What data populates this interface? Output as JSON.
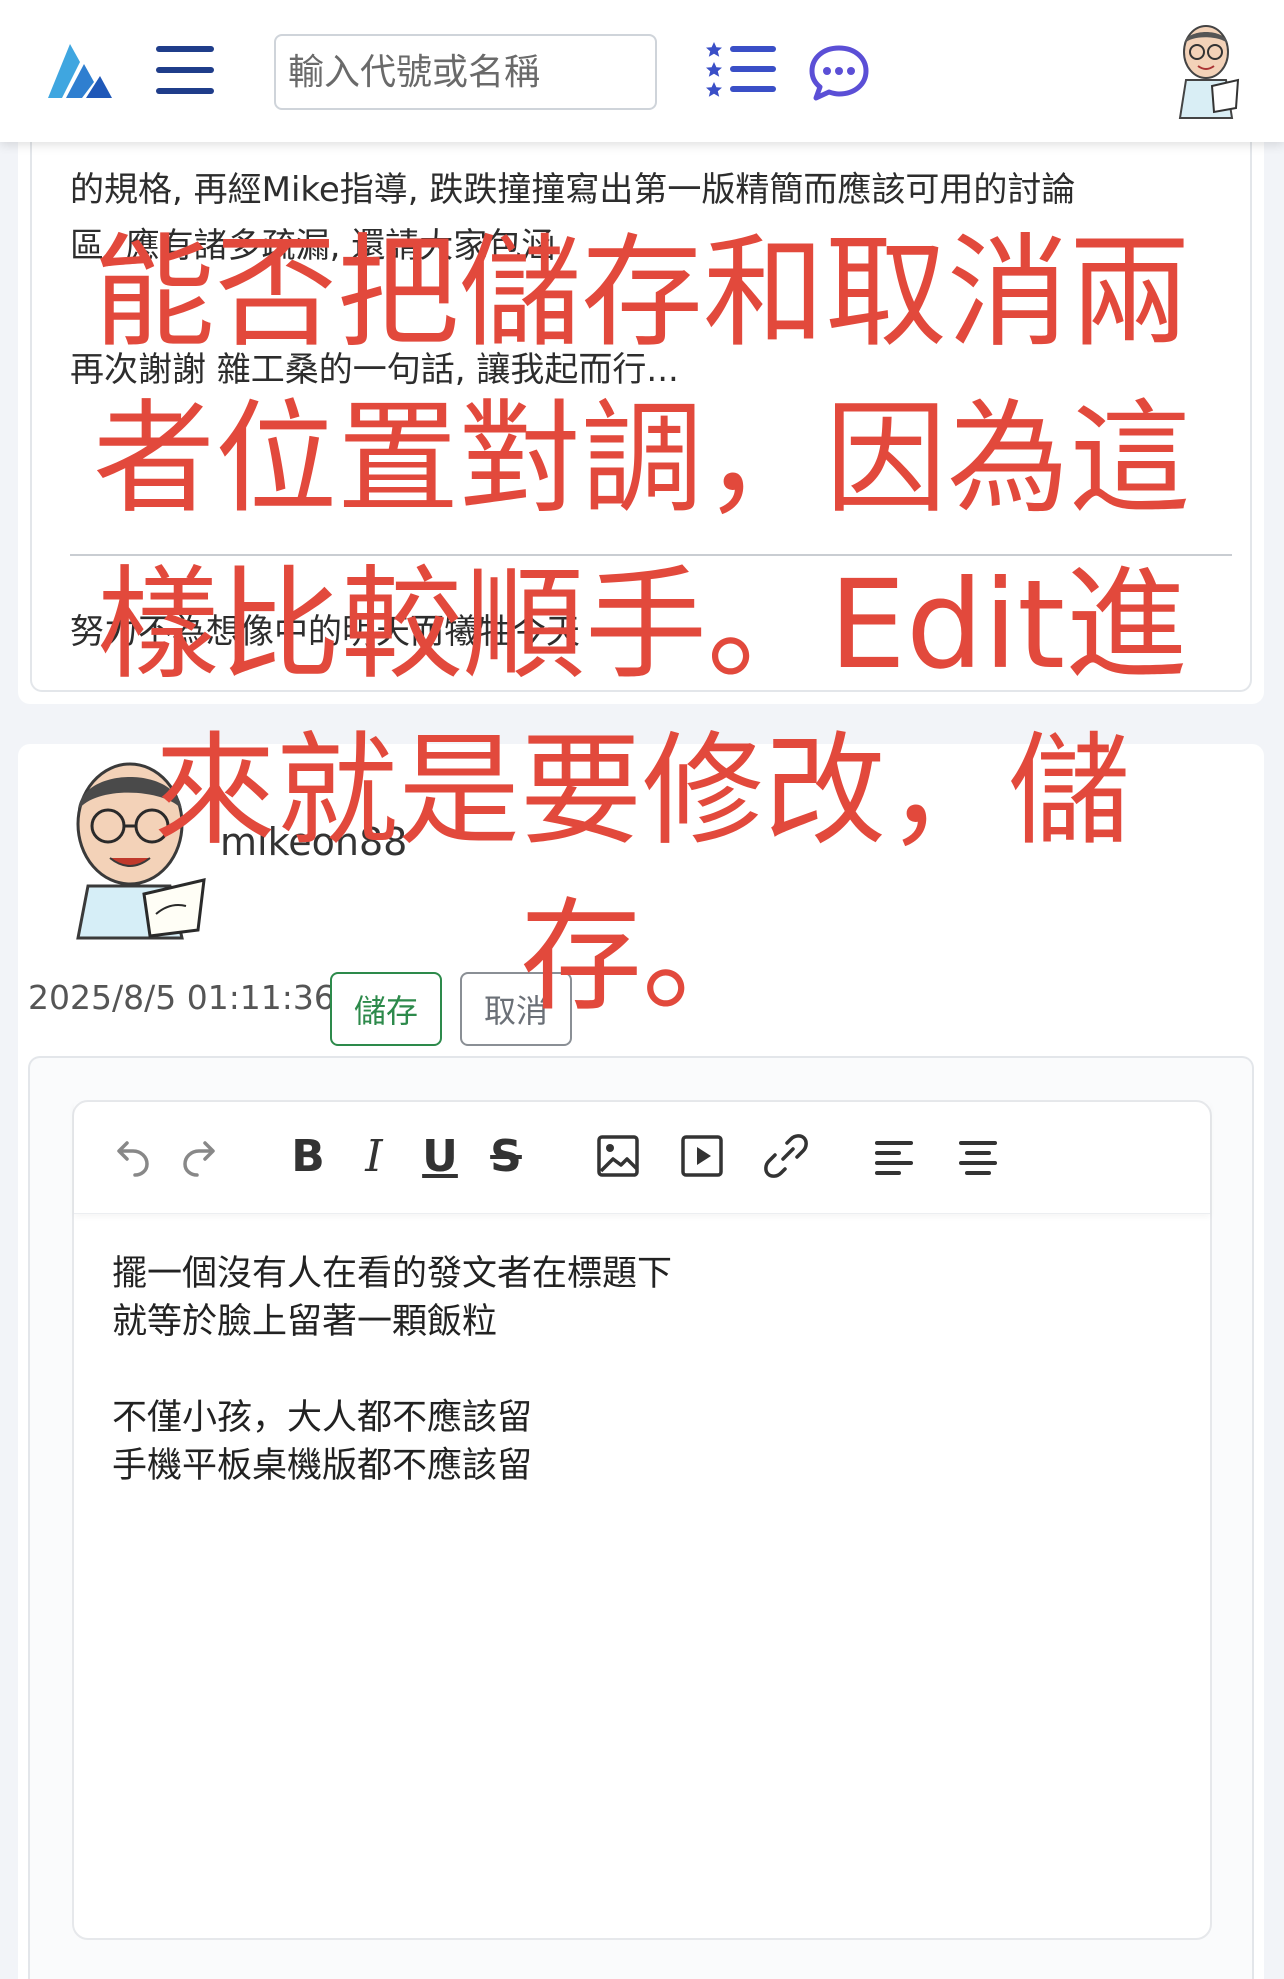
{
  "header": {
    "search_placeholder": "輸入代號或名稱"
  },
  "icons": {
    "logo": "logo-icon",
    "menu": "hamburger-menu-icon",
    "list": "star-list-icon",
    "chat": "chat-bubble-icon"
  },
  "previous_post": {
    "lines": [
      "的規格, 再經Mike指導, 跌跌撞撞寫出第一版精簡而應該可用的討論",
      "區. 應有諸多疏漏, 還請大家包涵",
      "再次謝謝 雜工桑的一句話, 讓我起而行...",
      "努力不為想像中的明天而犧牲今天"
    ]
  },
  "post": {
    "author": "mikeon88",
    "timestamp": "2025/8/5 01:11:36",
    "save_label": "儲存",
    "cancel_label": "取消"
  },
  "editor": {
    "toolbar": {
      "bold": "B",
      "italic": "I",
      "underline": "U",
      "strike": "S"
    },
    "content": [
      "擺一個沒有人在看的發文者在標題下",
      "就等於臉上留著一顆飯粒",
      "",
      "不僅小孩，大人都不應該留",
      "手機平板桌機版都不應該留"
    ]
  },
  "annotation": {
    "lines": [
      "能否把儲存和取消兩",
      "者位置對調，因為這",
      "樣比較順手。Edit進",
      "來就是要修改，儲",
      "存。"
    ],
    "color": "#e2493c"
  },
  "colors": {
    "save_green": "#2d8a4b",
    "nav_blue": "#1f3d8a",
    "chat_purple": "#5b4fd6"
  }
}
